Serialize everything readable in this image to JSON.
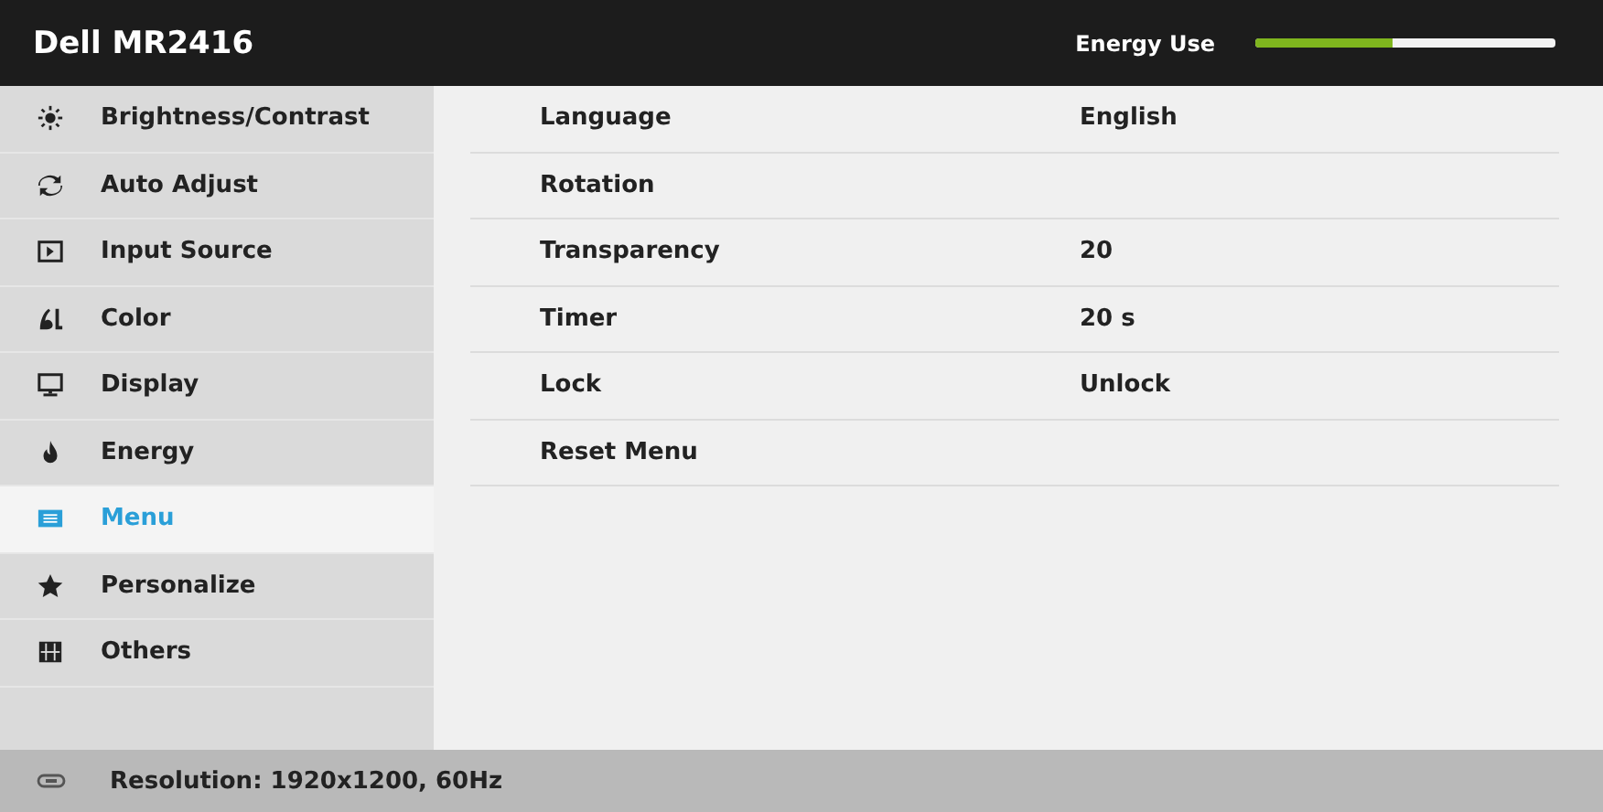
{
  "header": {
    "title": "Dell MR2416",
    "energy_label": "Energy Use",
    "energy": {
      "level": 0.46
    }
  },
  "sidebar": {
    "items": [
      {
        "kind": "brightness",
        "label": "Brightness/Contrast",
        "selected": false
      },
      {
        "kind": "auto",
        "label": "Auto Adjust",
        "selected": false
      },
      {
        "kind": "input",
        "label": "Input Source",
        "selected": false
      },
      {
        "kind": "color",
        "label": "Color",
        "selected": false
      },
      {
        "kind": "display",
        "label": "Display",
        "selected": false
      },
      {
        "kind": "energy",
        "label": "Energy",
        "selected": false
      },
      {
        "kind": "menu",
        "label": "Menu",
        "selected": true
      },
      {
        "kind": "personalize",
        "label": "Personalize",
        "selected": false
      },
      {
        "kind": "others",
        "label": "Others",
        "selected": false
      }
    ]
  },
  "settings": [
    {
      "label": "Language",
      "value": "English"
    },
    {
      "label": "Rotation"
    },
    {
      "label": "Transparency",
      "value": "20"
    },
    {
      "label": "Timer",
      "value": "20 s"
    },
    {
      "label": "Lock",
      "value": "Unlock"
    },
    {
      "label": "Reset Menu"
    }
  ],
  "status_bar": {
    "text": "Resolution: 1920x1200, 60Hz"
  }
}
